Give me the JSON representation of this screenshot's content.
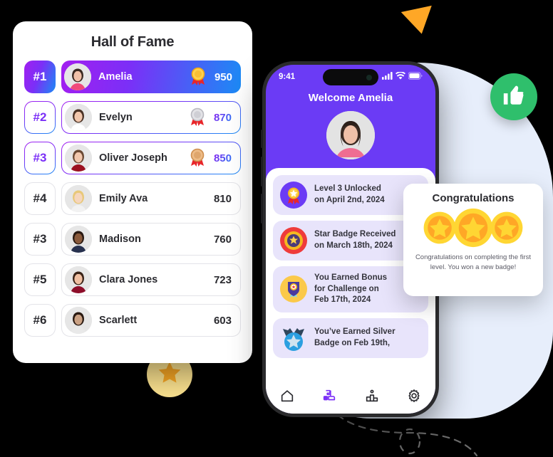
{
  "leaderboard": {
    "title": "Hall of Fame",
    "rows": [
      {
        "rank": "#1",
        "name": "Amelia",
        "score": "950",
        "medal": "gold-medal-icon"
      },
      {
        "rank": "#2",
        "name": "Evelyn",
        "score": "870",
        "medal": "silver-medal-icon"
      },
      {
        "rank": "#3",
        "name": "Oliver Joseph",
        "score": "850",
        "medal": "bronze-medal-icon"
      },
      {
        "rank": "#4",
        "name": "Emily Ava",
        "score": "810",
        "medal": ""
      },
      {
        "rank": "#3",
        "name": "Madison",
        "score": "760",
        "medal": ""
      },
      {
        "rank": "#5",
        "name": "Clara Jones",
        "score": "723",
        "medal": ""
      },
      {
        "rank": "#6",
        "name": "Scarlett",
        "score": "603",
        "medal": ""
      }
    ]
  },
  "phone": {
    "status": {
      "time": "9:41",
      "signal": "cellular-signal-icon",
      "wifi": "wifi-icon",
      "battery": "battery-icon"
    },
    "welcome": "Welcome Amelia",
    "avatar": "user-avatar",
    "notifications": [
      {
        "icon": "level-badge-icon",
        "line1": "Level 3 Unlocked",
        "line2": "on April 2nd, 2024"
      },
      {
        "icon": "star-badge-icon",
        "line1": "Star Badge Received",
        "line2": "on March 18th, 2024"
      },
      {
        "icon": "bonus-badge-icon",
        "line1": "You Earned Bonus",
        "line2": "for Challenge on",
        "line3": "Feb 17th, 2024"
      },
      {
        "icon": "silver-badge-icon",
        "line1": "You’ve Earned Silver",
        "line2": "Badge on Feb 19th,"
      }
    ],
    "nav": [
      {
        "name": "nav-home",
        "icon": "home-icon",
        "active": false
      },
      {
        "name": "nav-badges",
        "icon": "badge-icon",
        "active": true
      },
      {
        "name": "nav-leaderboard",
        "icon": "podium-icon",
        "active": false
      },
      {
        "name": "nav-settings",
        "icon": "gear-icon",
        "active": false
      }
    ]
  },
  "congrats": {
    "title": "Congratulations",
    "message": "Congratulations on completing the first level. You won a new badge!",
    "coins": 3
  },
  "decor": {
    "triangle": "orange-triangle",
    "thumbs_up": "thumbs-up-icon",
    "star_circle": "star-icon",
    "dashed_path": "dashed-curve"
  },
  "colors": {
    "grad_start": "#a21ff0",
    "grad_mid": "#7b2ff7",
    "grad_end": "#1b8bf5",
    "phone_bg": "#6b3bf5",
    "blob": "#e7eefb",
    "thumb_green": "#2fbf6c",
    "star_yellow": "#f9e08e",
    "triangle_orange": "#ffa726",
    "card_lilac": "#e8e4fb"
  }
}
